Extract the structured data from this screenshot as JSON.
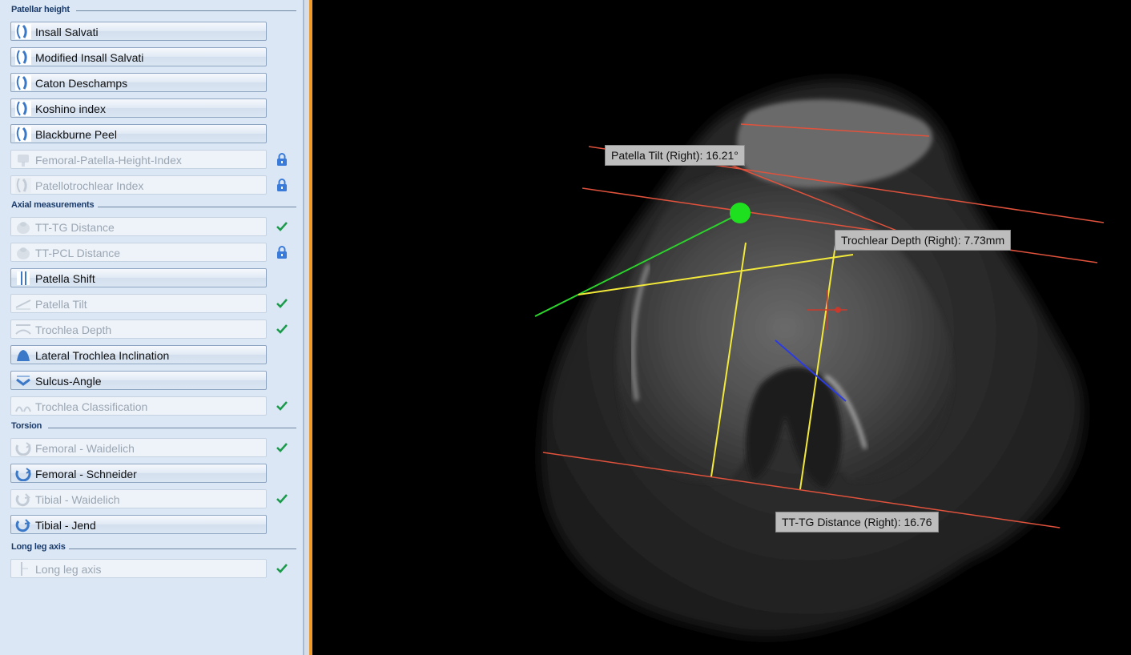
{
  "sections": {
    "patellar_height": "Patellar height",
    "axial": "Axial measurements",
    "torsion": "Torsion",
    "long_leg": "Long leg axis"
  },
  "buttons": [
    {
      "label": "Insall Salvati",
      "enabled": true,
      "status": "none",
      "icon": "patella-height-icon"
    },
    {
      "label": "Modified Insall Salvati",
      "enabled": true,
      "status": "none",
      "icon": "patella-height-icon"
    },
    {
      "label": "Caton Deschamps",
      "enabled": true,
      "status": "none",
      "icon": "patella-height-icon"
    },
    {
      "label": "Koshino index",
      "enabled": true,
      "status": "none",
      "icon": "patella-height-icon"
    },
    {
      "label": "Blackburne Peel",
      "enabled": true,
      "status": "none",
      "icon": "patella-height-icon"
    },
    {
      "label": "Femoral-Patella-Height-Index",
      "enabled": false,
      "status": "locked",
      "icon": "femur-icon"
    },
    {
      "label": "Patellotrochlear Index",
      "enabled": false,
      "status": "locked",
      "icon": "patella-height-icon"
    },
    {
      "label": "TT-TG Distance",
      "enabled": false,
      "status": "done",
      "icon": "knee-axial-icon"
    },
    {
      "label": "TT-PCL Distance",
      "enabled": false,
      "status": "locked",
      "icon": "knee-axial-icon"
    },
    {
      "label": "Patella Shift",
      "enabled": true,
      "status": "none",
      "icon": "patella-shift-icon"
    },
    {
      "label": "Patella Tilt",
      "enabled": false,
      "status": "done",
      "icon": "patella-tilt-icon"
    },
    {
      "label": "Trochlea Depth",
      "enabled": false,
      "status": "done",
      "icon": "trochlea-depth-icon"
    },
    {
      "label": "Lateral Trochlea Inclination",
      "enabled": true,
      "status": "none",
      "icon": "trochlea-inclination-icon"
    },
    {
      "label": "Sulcus-Angle",
      "enabled": true,
      "status": "none",
      "icon": "sulcus-angle-icon"
    },
    {
      "label": "Trochlea Classification",
      "enabled": false,
      "status": "done",
      "icon": "trochlea-classification-icon"
    },
    {
      "label": "Femoral - Waidelich",
      "enabled": false,
      "status": "done",
      "icon": "femoral-torsion-icon"
    },
    {
      "label": "Femoral - Schneider",
      "enabled": true,
      "status": "none",
      "icon": "femoral-torsion-icon"
    },
    {
      "label": "Tibial - Waidelich",
      "enabled": false,
      "status": "done",
      "icon": "tibial-torsion-icon"
    },
    {
      "label": "Tibial - Jend",
      "enabled": true,
      "status": "none",
      "icon": "tibial-torsion-icon"
    },
    {
      "label": "Long leg axis",
      "enabled": false,
      "status": "done",
      "icon": "long-leg-axis-icon"
    }
  ],
  "measurements": {
    "patella_tilt": "Patella Tilt (Right): 16.21°",
    "trochlear_depth": "Trochlear Depth (Right): 7.73mm",
    "tt_tg": "TT-TG Distance (Right): 16.76"
  },
  "colors": {
    "accent_orange": "#f19a2c",
    "line_red": "#e0523c",
    "line_yellow": "#f2e93a",
    "line_green": "#2bd52b",
    "line_blue": "#2b3be0",
    "check_green": "#1a9a4a",
    "lock_blue": "#3a7ad8"
  }
}
